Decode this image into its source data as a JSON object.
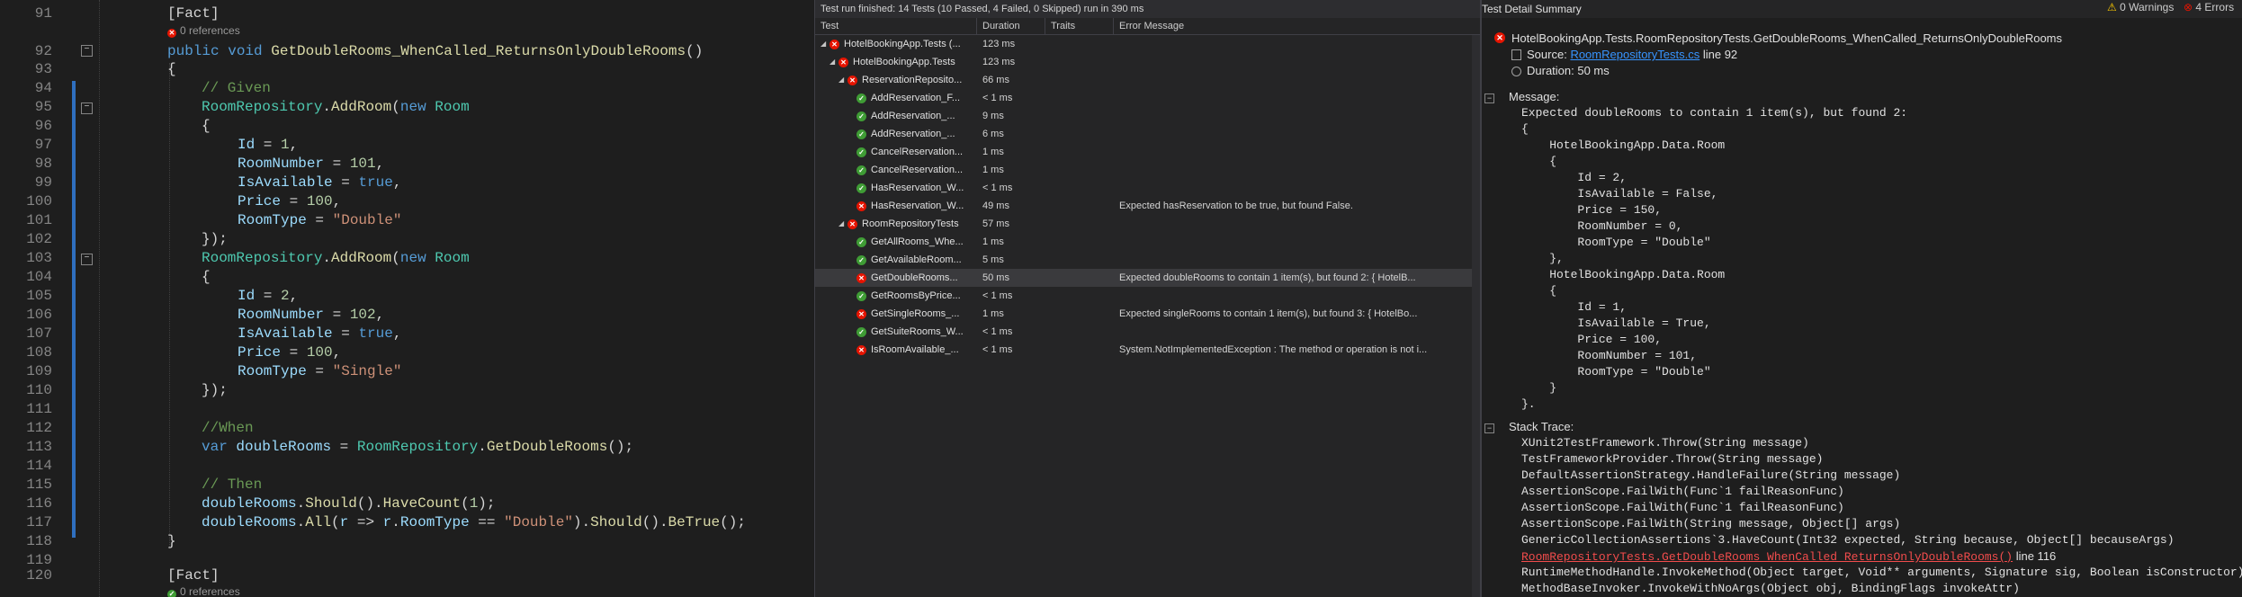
{
  "editor": {
    "line_numbers": [
      "91",
      "92",
      "93",
      "94",
      "95",
      "96",
      "97",
      "98",
      "99",
      "100",
      "101",
      "102",
      "103",
      "104",
      "105",
      "106",
      "107",
      "108",
      "109",
      "110",
      "111",
      "112",
      "113",
      "114",
      "115",
      "116",
      "117",
      "118",
      "119",
      "120"
    ],
    "attr_fact_top": "[Fact]",
    "lens_top": "0 references",
    "method_public": "public",
    "method_void": "void",
    "method_name": "GetDoubleRooms_WhenCalled_ReturnsOnlyDoubleRooms",
    "method_parens": "()",
    "brace_open": "{",
    "brace_close": "}",
    "comment_given": "// Given",
    "repo_class": "RoomRepository",
    "add_room": "AddRoom",
    "kw_new": "new",
    "room_type": "Room",
    "inner_open": "{",
    "id_prop": "Id",
    "id1": "1",
    "roomnumber_prop": "RoomNumber",
    "rn1": "101",
    "isavailable_prop": "IsAvailable",
    "true_kw": "true",
    "price_prop": "Price",
    "price1": "100",
    "roomtype_prop": "RoomType",
    "rt1": "\"Double\"",
    "inner_close": "});",
    "id2": "2",
    "rn2": "102",
    "price2": "100",
    "rt2": "\"Single\"",
    "comment_when": "//When",
    "kw_var": "var",
    "var_doublerooms": "doubleRooms",
    "get_double_rooms": "GetDoubleRooms",
    "comment_then": "// Then",
    "should": "Should",
    "have_count": "HaveCount",
    "count_val": "1",
    "all_m": "All",
    "lambda_r": "r",
    "be_true": "BeTrue",
    "attr_fact_bottom": "[Fact]",
    "lens_bottom": "0 references"
  },
  "explorer": {
    "status": "Test run finished: 14 Tests (10 Passed, 4 Failed, 0 Skipped) run in 390 ms",
    "headers": [
      "Test",
      "Duration",
      "Traits",
      "Error Message"
    ],
    "rows": [
      {
        "name": "HotelBookingApp.Tests (...",
        "dur": "123 ms",
        "err": "",
        "status": "fail",
        "level": 0,
        "expander": "◢"
      },
      {
        "name": "HotelBookingApp.Tests",
        "dur": "123 ms",
        "err": "",
        "status": "fail",
        "level": 1,
        "expander": "◢"
      },
      {
        "name": "ReservationReposito...",
        "dur": "66 ms",
        "err": "",
        "status": "fail",
        "level": 2,
        "expander": "◢"
      },
      {
        "name": "AddReservation_F...",
        "dur": "< 1 ms",
        "err": "",
        "status": "pass",
        "level": 3,
        "expander": ""
      },
      {
        "name": "AddReservation_...",
        "dur": "9 ms",
        "err": "",
        "status": "pass",
        "level": 3,
        "expander": ""
      },
      {
        "name": "AddReservation_...",
        "dur": "6 ms",
        "err": "",
        "status": "pass",
        "level": 3,
        "expander": ""
      },
      {
        "name": "CancelReservation...",
        "dur": "1 ms",
        "err": "",
        "status": "pass",
        "level": 3,
        "expander": ""
      },
      {
        "name": "CancelReservation...",
        "dur": "1 ms",
        "err": "",
        "status": "pass",
        "level": 3,
        "expander": ""
      },
      {
        "name": "HasReservation_W...",
        "dur": "< 1 ms",
        "err": "",
        "status": "pass",
        "level": 3,
        "expander": ""
      },
      {
        "name": "HasReservation_W...",
        "dur": "49 ms",
        "err": "Expected hasReservation to be true, but found False.",
        "status": "fail",
        "level": 3,
        "expander": ""
      },
      {
        "name": "RoomRepositoryTests",
        "dur": "57 ms",
        "err": "",
        "status": "fail",
        "level": 2,
        "expander": "◢"
      },
      {
        "name": "GetAllRooms_Whe...",
        "dur": "1 ms",
        "err": "",
        "status": "pass",
        "level": 3,
        "expander": ""
      },
      {
        "name": "GetAvailableRoom...",
        "dur": "5 ms",
        "err": "",
        "status": "pass",
        "level": 3,
        "expander": ""
      },
      {
        "name": "GetDoubleRooms...",
        "dur": "50 ms",
        "err": "Expected doubleRooms to contain 1 item(s), but found 2: {     HotelB...",
        "status": "fail",
        "level": 3,
        "expander": "",
        "selected": true
      },
      {
        "name": "GetRoomsByPrice...",
        "dur": "< 1 ms",
        "err": "",
        "status": "pass",
        "level": 3,
        "expander": ""
      },
      {
        "name": "GetSingleRooms_...",
        "dur": "1 ms",
        "err": "Expected singleRooms to contain 1 item(s), but found 3: {     HotelBo...",
        "status": "fail",
        "level": 3,
        "expander": ""
      },
      {
        "name": "GetSuiteRooms_W...",
        "dur": "< 1 ms",
        "err": "",
        "status": "pass",
        "level": 3,
        "expander": ""
      },
      {
        "name": "IsRoomAvailable_...",
        "dur": "< 1 ms",
        "err": "System.NotImplementedException : The method or operation is not i...",
        "status": "fail",
        "level": 3,
        "expander": ""
      }
    ]
  },
  "detail": {
    "title": "Test Detail Summary",
    "warnings": "0 Warnings",
    "errors": "4 Errors",
    "test_name": "HotelBookingApp.Tests.RoomRepositoryTests.GetDoubleRooms_WhenCalled_ReturnsOnlyDoubleRooms",
    "source_label": "Source:",
    "source_file": "RoomRepositoryTests.cs",
    "source_line": "line 92",
    "duration": "Duration: 50 ms",
    "message_label": "Message:",
    "message_lines": [
      "Expected doubleRooms to contain 1 item(s), but found 2:",
      "{",
      "    HotelBookingApp.Data.Room",
      "    {",
      "        Id = 2,",
      "        IsAvailable = False,",
      "        Price = 150,",
      "        RoomNumber = 0,",
      "        RoomType = \"Double\"",
      "    },",
      "    HotelBookingApp.Data.Room",
      "    {",
      "        Id = 1,",
      "        IsAvailable = True,",
      "        Price = 100,",
      "        RoomNumber = 101,",
      "        RoomType = \"Double\"",
      "    }",
      "}."
    ],
    "stack_label": "Stack Trace:",
    "stack_lines": [
      "XUnit2TestFramework.Throw(String message)",
      "TestFrameworkProvider.Throw(String message)",
      "DefaultAssertionStrategy.HandleFailure(String message)",
      "AssertionScope.FailWith(Func`1 failReasonFunc)",
      "AssertionScope.FailWith(Func`1 failReasonFunc)",
      "AssertionScope.FailWith(String message, Object[] args)",
      "GenericCollectionAssertions`3.HaveCount(Int32 expected, String because, Object[] becauseArgs)"
    ],
    "stack_link": "RoomRepositoryTests.GetDoubleRooms_WhenCalled_ReturnsOnlyDoubleRooms()",
    "stack_link_line": "line 116",
    "stack_after": [
      "RuntimeMethodHandle.InvokeMethod(Object target, Void** arguments, Signature sig, Boolean isConstructor)",
      "MethodBaseInvoker.InvokeWithNoArgs(Object obj, BindingFlags invokeAttr)"
    ]
  }
}
